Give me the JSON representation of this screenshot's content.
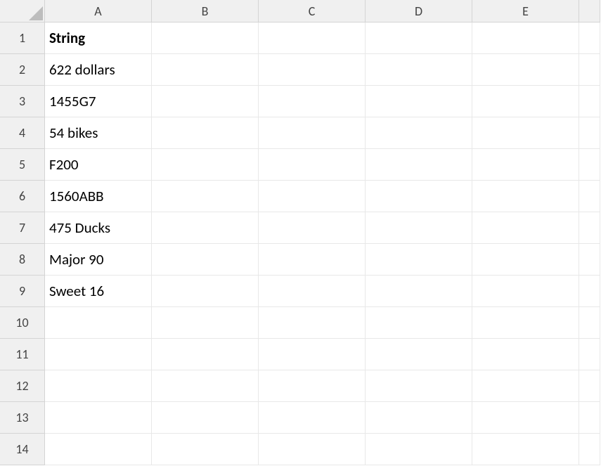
{
  "columns": [
    "A",
    "B",
    "C",
    "D",
    "E"
  ],
  "rows": [
    1,
    2,
    3,
    4,
    5,
    6,
    7,
    8,
    9,
    10,
    11,
    12,
    13,
    14
  ],
  "cells": {
    "A1": {
      "value": "String",
      "bold": true
    },
    "A2": {
      "value": "622 dollars",
      "bold": false
    },
    "A3": {
      "value": "1455G7",
      "bold": false
    },
    "A4": {
      "value": "54 bikes",
      "bold": false
    },
    "A5": {
      "value": "F200",
      "bold": false
    },
    "A6": {
      "value": "1560ABB",
      "bold": false
    },
    "A7": {
      "value": "475 Ducks",
      "bold": false
    },
    "A8": {
      "value": "Major 90",
      "bold": false
    },
    "A9": {
      "value": "Sweet 16",
      "bold": false
    }
  }
}
